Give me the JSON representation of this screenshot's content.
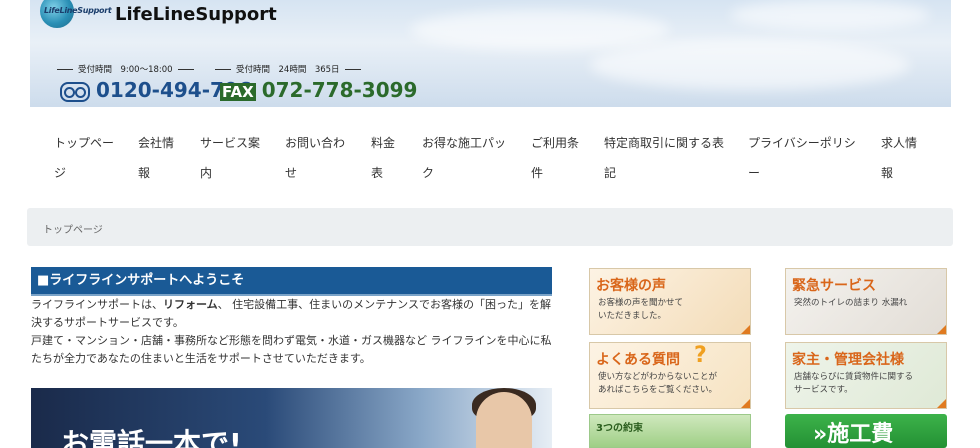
{
  "header": {
    "logo_text": "LifeLineSupport",
    "site_title": "LifeLineSupport",
    "hours_free": "受付時間　9:00～18:00",
    "hours_fax": "受付時間　24時間　365日",
    "free_dial": "0120-494-706",
    "fax_label": "FAX",
    "fax_number": "072-778-3099"
  },
  "nav": {
    "items": [
      {
        "label": "トップページ"
      },
      {
        "label": "会社情報"
      },
      {
        "label": "サービス案内"
      },
      {
        "label": "お問い合わせ"
      },
      {
        "label": "料金表"
      },
      {
        "label": "お得な施工パック"
      },
      {
        "label": "ご利用条件"
      },
      {
        "label": "特定商取引に関する表記"
      },
      {
        "label": "プライバシーポリシー"
      },
      {
        "label": "求人情報"
      }
    ]
  },
  "breadcrumb": {
    "current": "トップページ"
  },
  "main": {
    "section_title": "■ライフラインサポートへようこそ",
    "intro_part1": "ライフラインサポートは、",
    "intro_bold": "リフォーム",
    "intro_part2": "、 住宅設備工事、住まいのメンテナンスでお客様の「困った」を解決するサポートサービスです。",
    "intro_line2": "戸建て・マンション・店舗・事務所など形態を問わず電気・水道・ガス機器など ライフラインを中心に私たちが全力であなたの住まいと生活をサポートさせていただきます。",
    "hero_text": "お電話一本で!"
  },
  "sidebar": {
    "voice": {
      "title": "お客様の声",
      "sub": "お客様の声を聞かせて\nいただきました。"
    },
    "emergency": {
      "title": "緊急サービス",
      "sub": "突然のトイレの詰まり 水漏れ"
    },
    "faq": {
      "title": "よくある質問",
      "mark": "?",
      "sub": "使い方などがわからないことが\nあればこちらをご覧ください。"
    },
    "owner": {
      "title": "家主・管理会社様",
      "sub": "店舗ならびに賃貸物件に関する\nサービスです。"
    },
    "promise": {
      "title": "3つの約束"
    },
    "works": {
      "title": "»施工費"
    }
  },
  "colors": {
    "section_title_bg": "#1a5a96",
    "accent_orange": "#d9661a",
    "works_green": "#239134",
    "breadcrumb_bg": "#eceff1"
  }
}
